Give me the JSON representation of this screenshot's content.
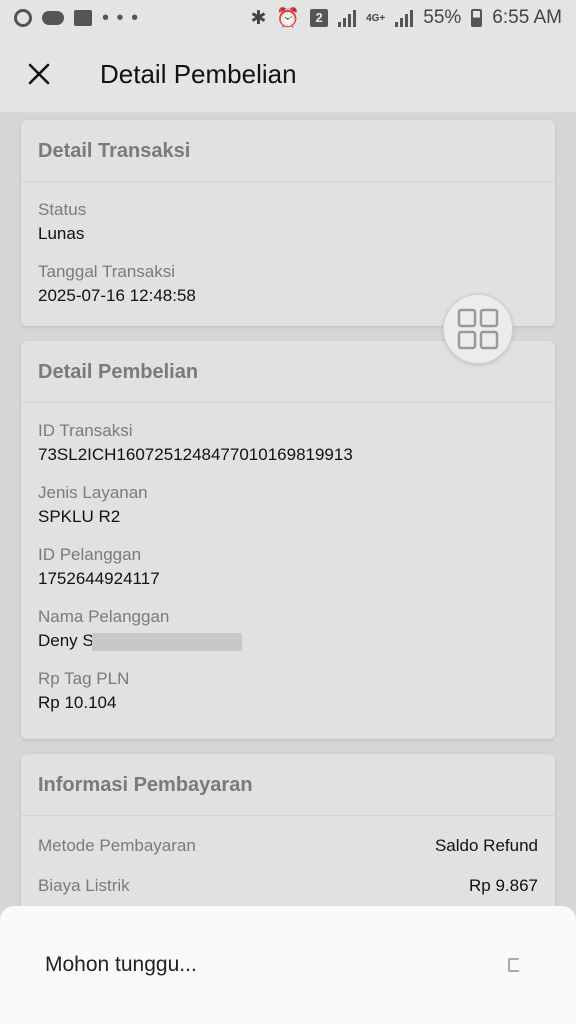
{
  "status_bar": {
    "battery": "55%",
    "time": "6:55 AM",
    "sim_badge": "2",
    "network": "4G+"
  },
  "header": {
    "title": "Detail Pembelian"
  },
  "transaksi": {
    "title": "Detail Transaksi",
    "fields": [
      {
        "label": "Status",
        "value": "Lunas"
      },
      {
        "label": "Tanggal Transaksi",
        "value": "2025-07-16 12:48:58"
      }
    ]
  },
  "pembelian": {
    "title": "Detail Pembelian",
    "fields": [
      {
        "label": "ID Transaksi",
        "value": "73SL2ICH1607251248477010169819913"
      },
      {
        "label": "Jenis Layanan",
        "value": "SPKLU R2"
      },
      {
        "label": "ID Pelanggan",
        "value": "1752644924117"
      },
      {
        "label": "Nama Pelanggan",
        "value": "Deny S"
      },
      {
        "label": "Rp Tag PLN",
        "value": "Rp 10.104"
      }
    ]
  },
  "pembayaran": {
    "title": "Informasi Pembayaran",
    "rows": [
      {
        "label": "Metode Pembayaran",
        "value": "Saldo Refund"
      },
      {
        "label": "Biaya Listrik",
        "value": "Rp 9.867"
      }
    ]
  },
  "loading": {
    "text": "Mohon tunggu..."
  }
}
